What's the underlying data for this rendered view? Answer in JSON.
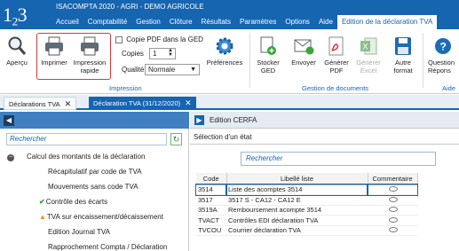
{
  "app": {
    "logo": "1₂3",
    "title": "ISACOMPTA 2020 - AGRI - DEMO AGRICOLE",
    "menu": [
      "Accueil",
      "Comptabilité",
      "Gestion",
      "Clôture",
      "Résultats",
      "Paramètres",
      "Options",
      "Aide",
      "Edition de la déclaration TVA"
    ]
  },
  "ribbon": {
    "apercu": "Aperçu",
    "imprimer": "Imprimer",
    "impression_rapide_1": "Impression",
    "impression_rapide_2": "rapide",
    "copie_pdf": "Copie PDF dans la GED",
    "copies_label": "Copies",
    "copies_value": "1",
    "qualite_label": "Qualité",
    "qualite_value": "Normale",
    "preferences": "Préférences",
    "group_impression": "Impression",
    "stocker_1": "Stocker",
    "stocker_2": "GED",
    "envoyer": "Envoyer",
    "generer_pdf_1": "Générer",
    "generer_pdf_2": "PDF",
    "generer_excel_1": "Générer",
    "generer_excel_2": "Excel",
    "autre_1": "Autre",
    "autre_2": "format",
    "group_docs": "Gestion de documents",
    "question_1": "Question",
    "question_2": "Répons",
    "group_aide": "Aide"
  },
  "tabs": [
    "Déclarations TVA",
    "Déclaration TVA (31/12/2020)"
  ],
  "left": {
    "search_placeholder": "Rechercher",
    "tree": [
      {
        "label": "Calcul des montants de la déclaration",
        "icon": "minus-icon"
      },
      {
        "label": "Récapitulatif par code de TVA",
        "icon": ""
      },
      {
        "label": "Mouvements sans code TVA",
        "icon": ""
      },
      {
        "label": "Contrôle des écarts",
        "icon": "check-icon"
      },
      {
        "label": "TVA sur encaissement/décaissement",
        "icon": "warning-icon"
      },
      {
        "label": "Edition Journal TVA",
        "icon": ""
      },
      {
        "label": "Rapprochement Compta / Déclaration",
        "icon": ""
      }
    ]
  },
  "right": {
    "header": "Edition CERFA",
    "selection_label": "Sélection d'un état",
    "search_placeholder": "Rechercher",
    "columns": [
      "Code",
      "Libellé liste",
      "Commentaire"
    ],
    "rows": [
      {
        "code": "3514",
        "libelle": "Liste des acomptes 3514"
      },
      {
        "code": "3517",
        "libelle": "3517 S - CA12 - CA12 E"
      },
      {
        "code": "3519A",
        "libelle": "Remboursement acompte 3514"
      },
      {
        "code": "TVACT",
        "libelle": "Contrôles EDI déclaration TVA"
      },
      {
        "code": "TVCOU",
        "libelle": "Courrier déclaration TVA"
      }
    ]
  },
  "colors": {
    "brand": "#1565b0",
    "highlight": "#d93a3a"
  }
}
